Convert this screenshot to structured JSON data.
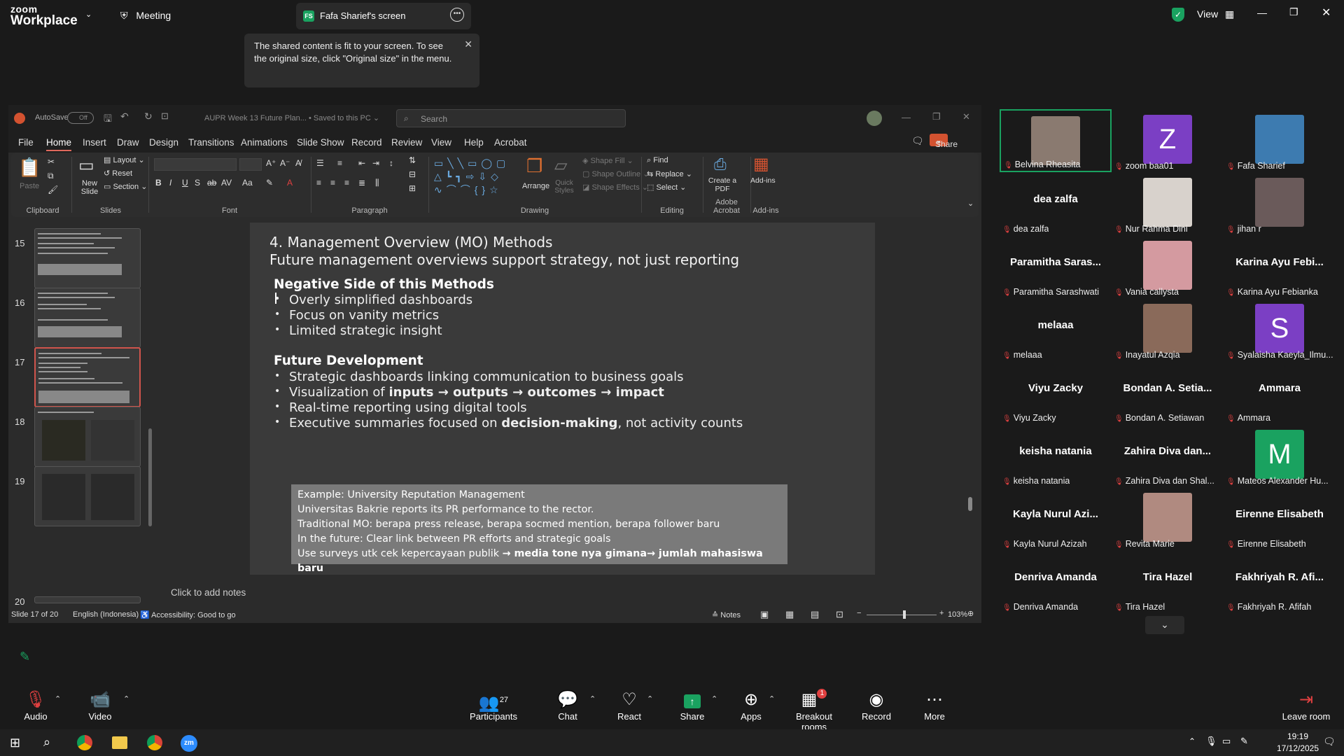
{
  "zoom": {
    "brand_top": "zoom",
    "brand_bottom": "Workplace",
    "meeting_label": "Meeting",
    "screen_badge": "FS",
    "screen_title": "Fafa Sharief's screen",
    "view_label": "View",
    "tooltip": "The shared content is fit to your screen. To see the original size, click \"Original size\" in the menu."
  },
  "ppt": {
    "autosave_label": "AutoSave",
    "autosave_state": "Off",
    "doc_title": "AUPR Week 13 Future Plan... • Saved to this PC ⌄",
    "search_placeholder": "Search",
    "tabs": [
      "File",
      "Home",
      "Insert",
      "Draw",
      "Design",
      "Transitions",
      "Animations",
      "Slide Show",
      "Record",
      "Review",
      "View",
      "Help",
      "Acrobat"
    ],
    "share_label": "Share",
    "ribbon": {
      "paste": "Paste",
      "new_slide": "New Slide",
      "layout": "Layout",
      "reset": "Reset",
      "section": "Section",
      "groups": {
        "clipboard": "Clipboard",
        "slides": "Slides",
        "font": "Font",
        "paragraph": "Paragraph",
        "drawing": "Drawing",
        "editing": "Editing",
        "adobe": "Adobe Acrobat",
        "addins": "Add-ins"
      },
      "arrange": "Arrange",
      "quick_styles": "Quick Styles",
      "shape_fill": "Shape Fill",
      "shape_outline": "Shape Outline",
      "shape_effects": "Shape Effects",
      "find": "Find",
      "replace": "Replace",
      "select": "Select",
      "create_pdf": "Create a PDF",
      "add_ins": "Add-ins"
    },
    "thumb_numbers": [
      "15",
      "16",
      "17",
      "18",
      "19",
      "20"
    ],
    "slide": {
      "title1": "4. Management Overview (MO) Methods",
      "title2": "Future management overviews support strategy, not just reporting",
      "neg_heading": "Negative Side of this Methods",
      "neg_items": [
        "Overly simplified dashboards",
        "Focus on vanity metrics",
        "Limited strategic insight"
      ],
      "future_heading": "Future Development",
      "future_item1": "Strategic dashboards linking communication to business goals",
      "future_item2_a": "Visualization of ",
      "future_item2_b": "inputs → outputs → outcomes → impact",
      "future_item3": "Real-time reporting using digital tools",
      "future_item4_a": "Executive summaries focused on ",
      "future_item4_b": "decision-making",
      "future_item4_c": ", not activity counts",
      "example_lines": [
        "Example: University Reputation Management",
        "Universitas Bakrie reports its PR performance to the rector.",
        "Traditional MO: berapa press release, berapa socmed mention, berapa follower baru",
        "In the future: Clear link between PR efforts and strategic goals"
      ],
      "example_last_a": "Use surveys utk cek kepercayaan publik ",
      "example_last_b": "→ media tone nya gimana→ jumlah mahasiswa baru"
    },
    "notes_placeholder": "Click to add notes",
    "status": {
      "slide_of": "Slide 17 of 20",
      "language": "English (Indonesia)",
      "accessibility": "Accessibility: Good to go",
      "notes": "Notes",
      "zoom": "103%"
    }
  },
  "gallery": [
    {
      "name": "",
      "label": "Belvina Rheasita",
      "kind": "photo",
      "color": "#8a7a70"
    },
    {
      "name": "",
      "label": "zoom baa01",
      "kind": "letter",
      "letter": "Z",
      "color": "#7b3fc4"
    },
    {
      "name": "",
      "label": "Fafa Sharief",
      "kind": "photo",
      "color": "#3d7bb0"
    },
    {
      "name": "dea zalfa",
      "label": "dea zalfa",
      "kind": "name"
    },
    {
      "name": "",
      "label": "Nur Rahma Dini",
      "kind": "photo",
      "color": "#d8d2cc"
    },
    {
      "name": "",
      "label": "jihan r",
      "kind": "photo",
      "color": "#6a5a5a"
    },
    {
      "name": "Paramitha Saras...",
      "label": "Paramitha Sarashwati",
      "kind": "name"
    },
    {
      "name": "",
      "label": "Vania callysta",
      "kind": "photo",
      "color": "#d49aa0"
    },
    {
      "name": "Karina Ayu Febi...",
      "label": "Karina Ayu Febianka",
      "kind": "name"
    },
    {
      "name": "melaaa",
      "label": "melaaa",
      "kind": "name"
    },
    {
      "name": "",
      "label": "Inayatul Azqia",
      "kind": "photo",
      "color": "#8a6a5a"
    },
    {
      "name": "",
      "label": "Syalaisha Kaeyla_Ilmu...",
      "kind": "letter",
      "letter": "S",
      "color": "#7b3fc4"
    },
    {
      "name": "Viyu Zacky",
      "label": "Viyu Zacky",
      "kind": "name"
    },
    {
      "name": "Bondan A. Setia...",
      "label": "Bondan A. Setiawan",
      "kind": "name"
    },
    {
      "name": "Ammara",
      "label": "Ammara",
      "kind": "name"
    },
    {
      "name": "keisha natania",
      "label": "keisha natania",
      "kind": "name"
    },
    {
      "name": "Zahira Diva dan...",
      "label": "Zahira Diva dan Shal...",
      "kind": "name"
    },
    {
      "name": "",
      "label": "Mateos Alexander Hu...",
      "kind": "letter",
      "letter": "M",
      "color": "#1aa260"
    },
    {
      "name": "Kayla Nurul Azi...",
      "label": "Kayla Nurul Azizah",
      "kind": "name"
    },
    {
      "name": "",
      "label": "Revita Marie",
      "kind": "photo",
      "color": "#b08a80"
    },
    {
      "name": "Eirenne Elisabeth",
      "label": "Eirenne Elisabeth",
      "kind": "name"
    },
    {
      "name": "Denriva Amanda",
      "label": "Denriva Amanda",
      "kind": "name"
    },
    {
      "name": "Tira Hazel",
      "label": "Tira Hazel",
      "kind": "name"
    },
    {
      "name": "Fakhriyah R. Afi...",
      "label": "Fakhriyah R. Afifah",
      "kind": "name"
    }
  ],
  "toolbar": {
    "audio": "Audio",
    "video": "Video",
    "participants": "Participants",
    "participants_count": "27",
    "chat": "Chat",
    "react": "React",
    "share": "Share",
    "apps": "Apps",
    "breakout": "Breakout rooms",
    "breakout_badge": "1",
    "record": "Record",
    "more": "More",
    "leave": "Leave room"
  },
  "taskbar": {
    "time": "19:19",
    "date": "17/12/2025"
  }
}
